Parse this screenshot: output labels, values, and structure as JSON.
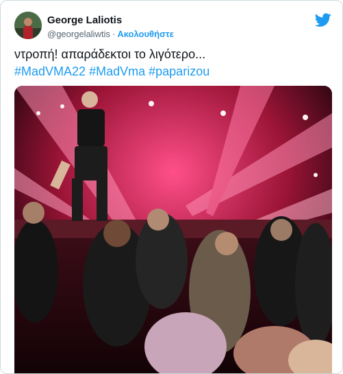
{
  "tweet": {
    "author_name": "George Laliotis",
    "handle": "@georgelaliwtis",
    "separator": "·",
    "follow_label": "Ακολουθήστε",
    "text": "ντροπή! απαράδεκτοι το λιγότερο...",
    "hashtags": [
      "#MadVMA22",
      "#MadVma",
      "#paparizou"
    ]
  },
  "icons": {
    "brand": "twitter-bird-icon",
    "avatar": "avatar"
  },
  "colors": {
    "link": "#1d9bf0",
    "text": "#0f1419",
    "secondary": "#536471",
    "border": "#cfd9de",
    "stage_light": "#e0306a"
  }
}
